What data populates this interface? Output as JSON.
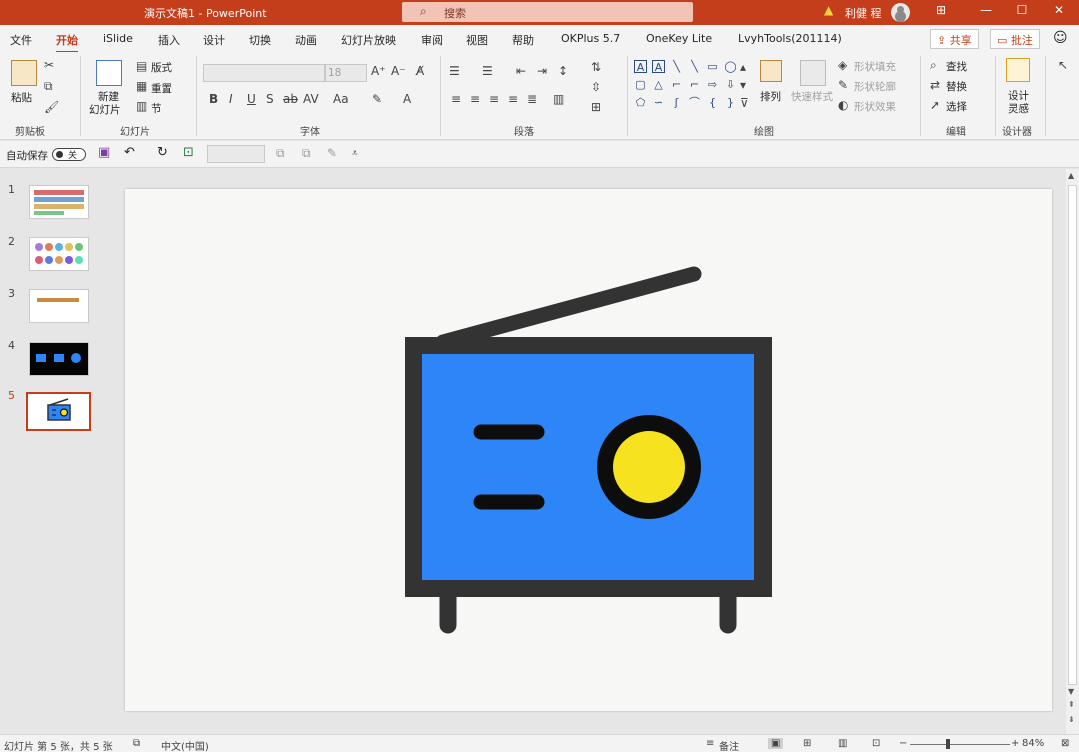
{
  "titlebar": {
    "doc_title": "演示文稿1  -  PowerPoint",
    "search_placeholder": "搜索",
    "user_name": "利健 程",
    "minimize": "—",
    "maximize": "☐",
    "close": "✕",
    "ribbon_display": "⊞"
  },
  "tabs": [
    {
      "label": "文件"
    },
    {
      "label": "开始"
    },
    {
      "label": "iSlide"
    },
    {
      "label": "插入"
    },
    {
      "label": "设计"
    },
    {
      "label": "切换"
    },
    {
      "label": "动画"
    },
    {
      "label": "幻灯片放映"
    },
    {
      "label": "审阅"
    },
    {
      "label": "视图"
    },
    {
      "label": "帮助"
    },
    {
      "label": "OKPlus 5.7"
    },
    {
      "label": "OneKey Lite"
    },
    {
      "label": "LvyhTools(201114)"
    }
  ],
  "share_label": "共享",
  "comment_label": "批注",
  "ribbon": {
    "clipboard": {
      "paste": "粘贴",
      "label": "剪贴板"
    },
    "slides": {
      "new_slide_1": "新建",
      "new_slide_2": "幻灯片",
      "layout": "版式",
      "reset": "重置",
      "section": "节",
      "label": "幻灯片"
    },
    "font": {
      "size": "18",
      "label": "字体"
    },
    "paragraph": {
      "label": "段落"
    },
    "drawing": {
      "arrange": "排列",
      "quick_styles": "快速样式",
      "fill": "形状填充",
      "outline": "形状轮廓",
      "effects": "形状效果",
      "label": "绘图"
    },
    "editing": {
      "find": "查找",
      "replace": "替换",
      "select": "选择",
      "label": "编辑"
    },
    "designer": {
      "line1": "设计",
      "line2": "灵感",
      "label": "设计器"
    }
  },
  "qat": {
    "autosave": "自动保存",
    "autosave_state": "关"
  },
  "slides": [
    {
      "num": "1"
    },
    {
      "num": "2"
    },
    {
      "num": "3"
    },
    {
      "num": "4"
    },
    {
      "num": "5"
    }
  ],
  "status": {
    "slide_info": "幻灯片 第 5 张，共 5 张",
    "language": "中文(中国)",
    "notes": "备注",
    "zoom": "84%",
    "zoom_minus": "−",
    "zoom_plus": "+"
  },
  "colors": {
    "accent": "#c43e1c",
    "radio_body": "#2d85f7",
    "radio_frame": "#333333",
    "speaker": "#f6e21f"
  }
}
